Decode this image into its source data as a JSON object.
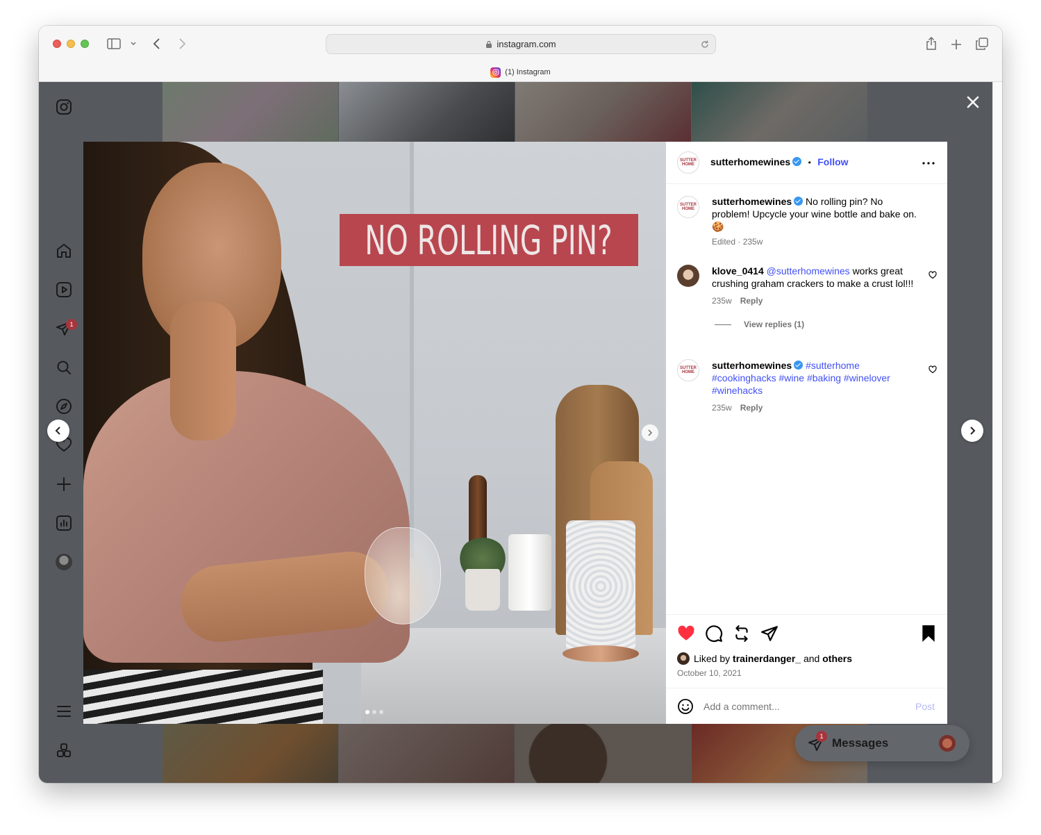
{
  "browser": {
    "url": "instagram.com",
    "tab_title": "(1) Instagram"
  },
  "sidebar": {
    "messages_badge": "1"
  },
  "post": {
    "image_headline": "NO ROLLING PIN?",
    "author": "sutterhomewines",
    "follow_label": "Follow",
    "avatar_text": "SUTTER HOME",
    "caption": {
      "username": "sutterhomewines",
      "text": "No rolling pin? No problem! Upcycle your wine bottle and bake on. 🍪",
      "meta": "Edited · 235w"
    },
    "comments": [
      {
        "username": "klove_0414",
        "mention": "@sutterhomewines",
        "text": "works great crushing graham crackers to make a crust lol!!!",
        "age": "235w",
        "reply_label": "Reply",
        "view_replies": "View replies (1)"
      },
      {
        "username": "sutterhomewines",
        "text": "#sutterhome #cookinghacks #wine #baking #winelover #winehacks",
        "age": "235w",
        "reply_label": "Reply"
      }
    ],
    "liked_by_prefix": "Liked by",
    "liked_by_user": "trainerdanger_",
    "liked_by_and": "and",
    "liked_by_others": "others",
    "date": "October 10, 2021",
    "comment_placeholder": "Add a comment...",
    "post_button": "Post"
  },
  "messages_widget": {
    "label": "Messages",
    "badge": "1"
  },
  "colors": {
    "like_red": "#ff3040",
    "link_blue": "#4150f7",
    "overlay": "#565a5f",
    "headline_bg": "#b8464f"
  }
}
